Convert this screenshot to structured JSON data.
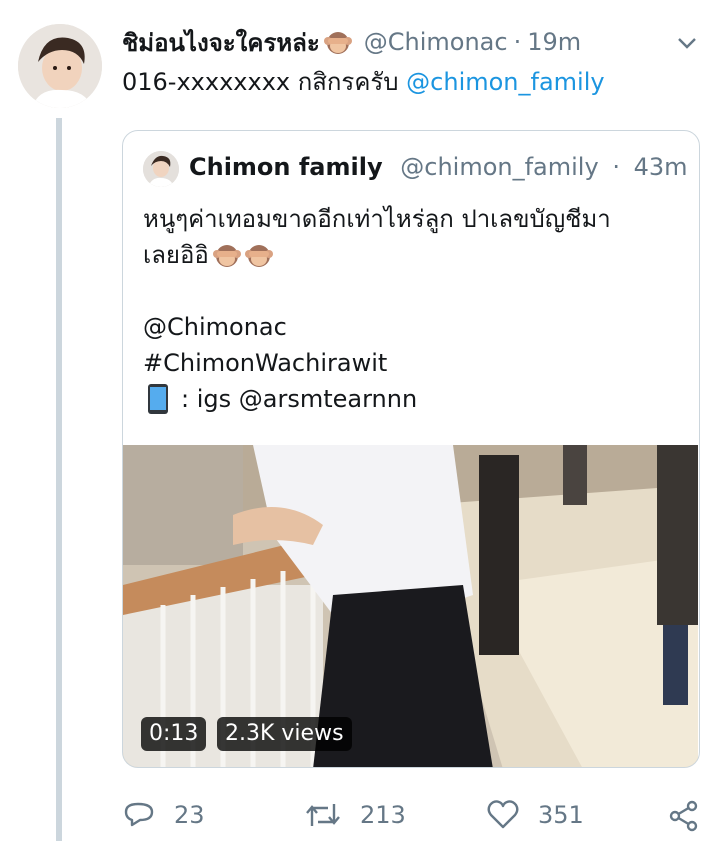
{
  "tweet": {
    "display_name": "ชิม่อนไงจะใครหล่ะ",
    "handle": "@Chimonac",
    "separator": "·",
    "time": "19m",
    "text_prefix": "016-xxxxxxxx กสิกรครับ",
    "mention": "@chimon_family"
  },
  "quoted": {
    "display_name": "Chimon family",
    "handle": "@chimon_family",
    "separator": "·",
    "time": "43m",
    "line1": "หนูๆค่าเทอมขาดอีกเท่าไหร่ลูก ปาเลขบัญชีมา",
    "line2": "เลยอิอิ",
    "line3": "@Chimonac",
    "line4": "#ChimonWachirawit",
    "line5": ": igs @arsmtearnnn",
    "video_duration": "0:13",
    "video_views": "2.3K views"
  },
  "actions": {
    "replies": "23",
    "retweets": "213",
    "likes": "351"
  },
  "colors": {
    "link": "#1b95e0",
    "secondary_text": "#657786",
    "border": "#ccd6dd"
  },
  "icons": [
    "see-no-evil-monkey-emoji",
    "mobile-phone-emoji",
    "chevron-down-icon",
    "reply-icon",
    "retweet-icon",
    "like-icon",
    "share-icon"
  ]
}
